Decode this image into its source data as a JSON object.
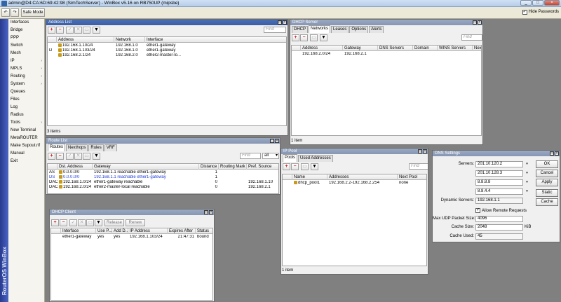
{
  "app": {
    "title": "admin@D4:CA:6D:69:42:98 (SimTechServer) - WinBox v5.16 on RB750UP (mipsbe)",
    "brand": "RouterOS WinBox"
  },
  "toolbar": {
    "undo_icon": "undo-icon",
    "redo_icon": "redo-icon",
    "safe_mode_label": "Safe Mode",
    "hide_passwords_label": "Hide Passwords",
    "hide_passwords_checked": true
  },
  "menu": {
    "items": [
      {
        "label": "Interfaces",
        "submenu": false
      },
      {
        "label": "Bridge",
        "submenu": false
      },
      {
        "label": "PPP",
        "submenu": false
      },
      {
        "label": "Switch",
        "submenu": false
      },
      {
        "label": "Mesh",
        "submenu": false
      },
      {
        "label": "IP",
        "submenu": true
      },
      {
        "label": "MPLS",
        "submenu": true
      },
      {
        "label": "Routing",
        "submenu": true
      },
      {
        "label": "System",
        "submenu": true
      },
      {
        "label": "Queues",
        "submenu": false
      },
      {
        "label": "Files",
        "submenu": false
      },
      {
        "label": "Log",
        "submenu": false
      },
      {
        "label": "Radius",
        "submenu": false
      },
      {
        "label": "Tools",
        "submenu": true
      },
      {
        "label": "New Terminal",
        "submenu": false
      },
      {
        "label": "MetaROUTER",
        "submenu": false
      },
      {
        "label": "Make Supout.rif",
        "submenu": false
      },
      {
        "label": "Manual",
        "submenu": false
      },
      {
        "label": "Exit",
        "submenu": false
      }
    ],
    "arrow": "›"
  },
  "common": {
    "find_placeholder": "Find",
    "add": "+",
    "remove": "−",
    "enable": "✓",
    "disable": "✕",
    "comment": "▭",
    "filter": "▼",
    "win_min": "_",
    "win_max": "□",
    "win_close": "×",
    "dropdown_arrow": "▾"
  },
  "address_list": {
    "title": "Address List",
    "columns": [
      "Address",
      "Network",
      "Interface"
    ],
    "rows": [
      {
        "flag": "",
        "address": "192.168.1.10/24",
        "network": "192.168.1.0",
        "interface": "ether1-gateway"
      },
      {
        "flag": "D",
        "address": "192.168.1.103/24",
        "network": "192.168.1.0",
        "interface": "ether1-gateway"
      },
      {
        "flag": "",
        "address": "192.168.2.1/24",
        "network": "192.168.2.0",
        "interface": "ether2-master-lo..."
      }
    ],
    "status": "3 items"
  },
  "dhcp_server": {
    "title": "DHCP Server",
    "tabs": [
      "DHCP",
      "Networks",
      "Leases",
      "Options",
      "Alerts"
    ],
    "active_tab": 1,
    "columns": [
      "Address",
      "Gateway",
      "DNS Servers",
      "Domain",
      "WINS Servers",
      "Nex"
    ],
    "rows": [
      {
        "address": "192.168.2.0/24",
        "gateway": "192.168.2.1"
      }
    ],
    "status": "1 item"
  },
  "route_list": {
    "title": "Route List",
    "tabs": [
      "Routes",
      "Nexthops",
      "Rules",
      "VRF"
    ],
    "active_tab": 0,
    "filter_value": "all",
    "columns": [
      "Dst. Address",
      "Gateway",
      "Distance",
      "Routing Mark",
      "Pref. Source"
    ],
    "rows": [
      {
        "flag": "AS",
        "dst": "0.0.0.0/0",
        "gateway": "192.168.1.1 reachable ether1-gateway",
        "distance": "1",
        "mark": "",
        "pref": "",
        "blue": false
      },
      {
        "flag": "DS",
        "dst": "0.0.0.0/0",
        "gateway": "192.168.1.1 reachable ether1-gateway",
        "distance": "1",
        "mark": "",
        "pref": "",
        "blue": true
      },
      {
        "flag": "DAC",
        "dst": "192.168.1.0/24",
        "gateway": "ether1-gateway reachable",
        "distance": "0",
        "mark": "",
        "pref": "192.168.1.10",
        "blue": false
      },
      {
        "flag": "DAC",
        "dst": "192.168.2.0/24",
        "gateway": "ether2-master-local reachable",
        "distance": "0",
        "mark": "",
        "pref": "192.168.2.1",
        "blue": false
      }
    ]
  },
  "dhcp_client": {
    "title": "DHCP Client",
    "release_label": "Release",
    "renew_label": "Renew",
    "columns": [
      "Interface",
      "Use P...",
      "Add D...",
      "IP Address",
      "Expires After",
      "Status"
    ],
    "rows": [
      {
        "interface": "ether1-gateway",
        "use_peer": "yes",
        "add_default": "yes",
        "ip": "192.168.1.103/24",
        "expires": "21:47:31",
        "status": "bound"
      }
    ]
  },
  "ip_pool": {
    "title": "IP Pool",
    "tabs": [
      "Pools",
      "Used Addresses"
    ],
    "active_tab": 0,
    "columns": [
      "Name",
      "Addresses",
      "Next Pool"
    ],
    "rows": [
      {
        "name": "dhcp_pool1",
        "addresses": "192.168.2.2-192.168.2.254",
        "next": "none"
      }
    ],
    "status": "1 item"
  },
  "dns_settings": {
    "title": "DNS Settings",
    "servers_label": "Servers:",
    "servers": [
      "201.10.120.2",
      "201.10.128.3",
      "8.8.8.8",
      "8.8.4.4"
    ],
    "dynamic_servers_label": "Dynamic Servers:",
    "dynamic_servers": "192.168.1.1",
    "allow_remote_label": "Allow Remote Requests",
    "allow_remote_checked": true,
    "max_udp_label": "Max UDP Packet Size:",
    "max_udp": "4096",
    "cache_size_label": "Cache Size:",
    "cache_size": "2048",
    "cache_size_unit": "KiB",
    "cache_used_label": "Cache Used:",
    "cache_used": "45",
    "buttons": [
      "OK",
      "Cancel",
      "Apply",
      "Static",
      "Cache"
    ]
  }
}
